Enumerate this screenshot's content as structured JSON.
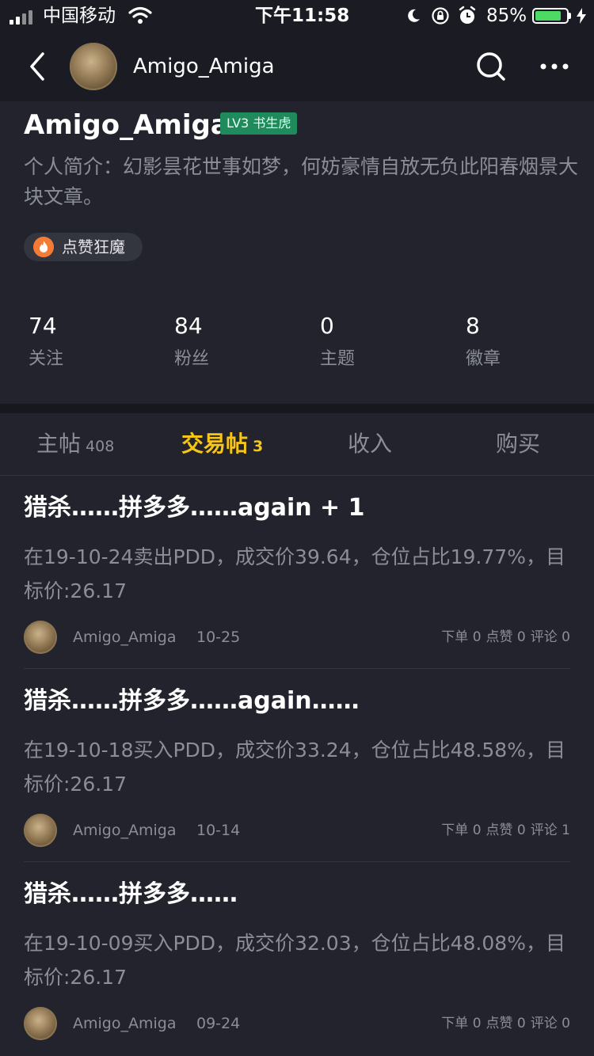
{
  "status_bar": {
    "carrier": "中国移动",
    "time": "下午11:58",
    "battery_percent": "85%",
    "battery_level": 0.85
  },
  "nav": {
    "title": "Amigo_Amiga"
  },
  "profile": {
    "name": "Amigo_Amiga",
    "level_badge": "LV3 书生虎",
    "bio": "个人简介：幻影昙花世事如梦，何妨豪情自放无负此阳春烟景大块文章。",
    "honor_chip": "点赞狂魔",
    "stats": [
      {
        "value": "74",
        "label": "关注"
      },
      {
        "value": "84",
        "label": "粉丝"
      },
      {
        "value": "0",
        "label": "主题"
      },
      {
        "value": "8",
        "label": "徽章"
      }
    ]
  },
  "tabs": [
    {
      "label": "主帖",
      "count": "408"
    },
    {
      "label": "交易帖",
      "count": "3"
    },
    {
      "label": "收入",
      "count": ""
    },
    {
      "label": "购买",
      "count": ""
    }
  ],
  "posts": [
    {
      "title": "猎杀……拼多多……again + 1",
      "body": "在19-10-24卖出PDD，成交价39.64，仓位占比19.77%，目标价:26.17",
      "author": "Amigo_Amiga",
      "date": "10-25",
      "orders": "下单 0",
      "likes": "点赞 0",
      "comments": "评论 0"
    },
    {
      "title": "猎杀……拼多多……again……",
      "body": "在19-10-18买入PDD，成交价33.24，仓位占比48.58%，目标价:26.17",
      "author": "Amigo_Amiga",
      "date": "10-14",
      "orders": "下单 0",
      "likes": "点赞 0",
      "comments": "评论 1"
    },
    {
      "title": "猎杀……拼多多……",
      "body": "在19-10-09买入PDD，成交价32.03，仓位占比48.08%，目标价:26.17",
      "author": "Amigo_Amiga",
      "date": "09-24",
      "orders": "下单 0",
      "likes": "点赞 0",
      "comments": "评论 0"
    }
  ],
  "colors": {
    "background": "#22232c",
    "accent_tab": "#f5c518",
    "level_badge": "#1f8a5b",
    "muted_text": "#8b8d97"
  },
  "icons": [
    "back-arrow-icon",
    "search-icon",
    "more-icon",
    "wifi-icon",
    "moon-icon",
    "rotation-lock-icon",
    "alarm-icon",
    "charging-icon",
    "flame-icon"
  ]
}
